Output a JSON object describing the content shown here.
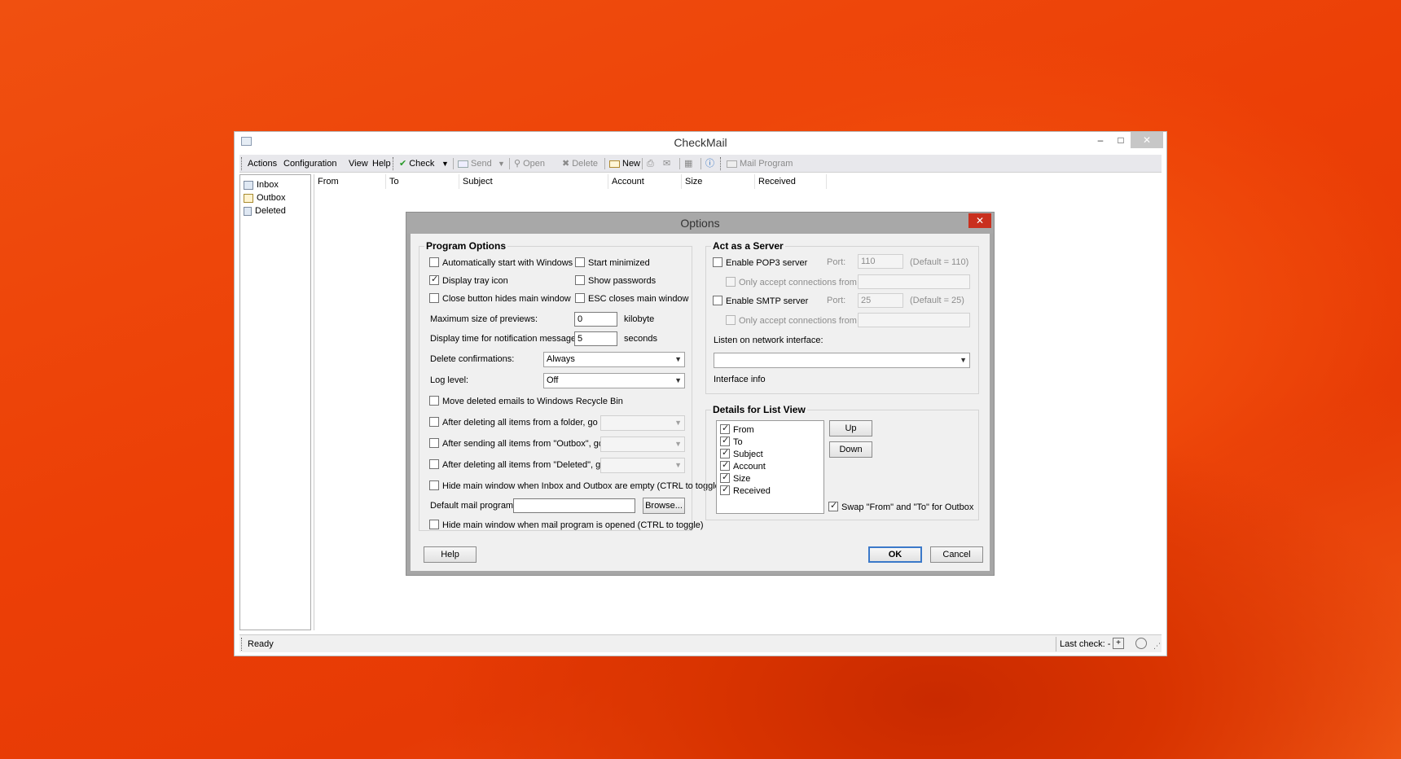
{
  "app": {
    "title": "CheckMail",
    "window_icon": "mail-icon"
  },
  "window_controls": {
    "minimize": "–",
    "maximize": "□",
    "close": "✕"
  },
  "toolbar": {
    "menu": [
      "Actions",
      "Configuration",
      "View",
      "Help"
    ],
    "check": "Check",
    "send": "Send",
    "open": "Open",
    "delete": "Delete",
    "new": "New",
    "mail_program": "Mail Program",
    "dropdown_arrow": "▼"
  },
  "folders": [
    {
      "label": "Inbox",
      "icon": "inbox-icon"
    },
    {
      "label": "Outbox",
      "icon": "outbox-icon"
    },
    {
      "label": "Deleted",
      "icon": "trash-icon"
    }
  ],
  "columns": [
    "From",
    "To",
    "Subject",
    "Account",
    "Size",
    "Received"
  ],
  "status": {
    "text": "Ready",
    "last_check": "Last check: -"
  },
  "dialog": {
    "title": "Options",
    "close": "✕",
    "program_options": {
      "title": "Program Options",
      "auto_start": {
        "label": "Automatically start with Windows",
        "checked": false
      },
      "start_minimized": {
        "label": "Start minimized",
        "checked": false
      },
      "display_tray": {
        "label": "Display tray icon",
        "checked": true
      },
      "show_passwords": {
        "label": "Show passwords",
        "checked": false
      },
      "close_hides": {
        "label": "Close button hides main window",
        "checked": false
      },
      "esc_closes": {
        "label": "ESC closes main window",
        "checked": false
      },
      "max_preview_label": "Maximum size of previews:",
      "max_preview_value": "0",
      "max_preview_unit": "kilobyte",
      "notif_time_label": "Display time for notification messages:",
      "notif_time_value": "5",
      "notif_time_unit": "seconds",
      "delete_conf_label": "Delete confirmations:",
      "delete_conf_value": "Always",
      "log_level_label": "Log level:",
      "log_level_value": "Off",
      "move_recycle": {
        "label": "Move deleted emails to Windows Recycle Bin",
        "checked": false
      },
      "after_delete_folder": {
        "label": "After deleting all items from a folder, go to:",
        "checked": false
      },
      "after_send_outbox": {
        "label": "After sending all items from \"Outbox\", go to:",
        "checked": false
      },
      "after_delete_deleted": {
        "label": "After deleting all items from \"Deleted\", go to:",
        "checked": false
      },
      "hide_when_empty": {
        "label": "Hide main window when Inbox and Outbox are empty (CTRL to toggle)",
        "checked": false
      },
      "default_mail_label": "Default mail program:",
      "default_mail_value": "",
      "browse": "Browse...",
      "hide_when_opened": {
        "label": "Hide main window when mail program is opened (CTRL to toggle)",
        "checked": false
      }
    },
    "server": {
      "title": "Act as a Server",
      "pop3": {
        "label": "Enable POP3 server",
        "checked": false
      },
      "port_label": "Port:",
      "pop3_port": "110",
      "pop3_default": "(Default = 110)",
      "pop3_only": {
        "label": "Only accept connections from",
        "checked": false
      },
      "smtp": {
        "label": "Enable SMTP server",
        "checked": false
      },
      "smtp_port": "25",
      "smtp_default": "(Default = 25)",
      "smtp_only": {
        "label": "Only accept connections from",
        "checked": false
      },
      "listen_label": "Listen on network interface:",
      "listen_value": "",
      "interface_info": "Interface info"
    },
    "details": {
      "title": "Details for List View",
      "items": [
        {
          "label": "From",
          "checked": true
        },
        {
          "label": "To",
          "checked": true
        },
        {
          "label": "Subject",
          "checked": true
        },
        {
          "label": "Account",
          "checked": true
        },
        {
          "label": "Size",
          "checked": true
        },
        {
          "label": "Received",
          "checked": true
        }
      ],
      "up": "Up",
      "down": "Down",
      "swap": {
        "label": "Swap \"From\" and \"To\" for Outbox",
        "checked": true
      }
    },
    "help": "Help",
    "ok": "OK",
    "cancel": "Cancel"
  }
}
